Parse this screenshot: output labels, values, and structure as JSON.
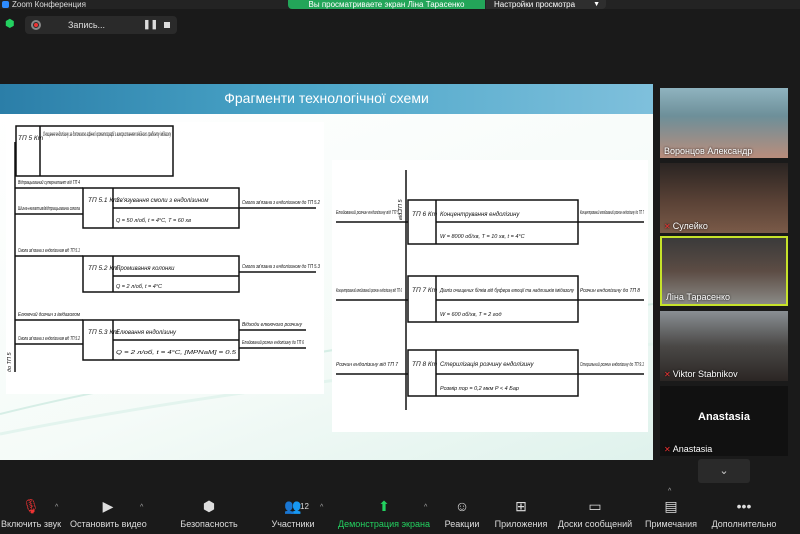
{
  "window": {
    "title": "Zoom Конференция"
  },
  "banner": {
    "text": "Вы просматриваете экран Ліна Тарасенко",
    "view_options": "Настройки просмотра"
  },
  "recording": {
    "label": "Запись..."
  },
  "slide": {
    "title": "Фрагменти технологічної схеми",
    "left": {
      "start_code": "ТП 5 Кт",
      "start_text": "Очищення ендолізину за допомогою афінної хроматографії з використанням лінійного градієнту імідазолу",
      "axis_label": "до ТП 5",
      "rows": [
        {
          "in1": "Відпрацьований супернатант від ТП 4",
          "in2": "Шина-негатив/відпрацьована смола",
          "code": "ТП 5.1 Кт",
          "text": "Зв'язування смоли з ендолізином",
          "params": "Q = 50 л/об, t = 4°С, T = 60 хв",
          "out": "Смола зв'язана з ендолізином до ТП 5.2"
        },
        {
          "in1": "Смола зв'язана з ендолізином від ТП 5.1",
          "code": "ТП 5.2 Кт",
          "text": "Промивання колонки",
          "params": "Q = 2 л/об, t = 4°С",
          "out": "Смола зв'язана з ендолізином до ТП 5.3"
        },
        {
          "in1": "Елюючий дозчин з імідазолом",
          "in2": "Смола зв'язана з ендолізином від ТП 5.2",
          "code": "ТП 5.3 Кт",
          "text": "Елювання ендолізину",
          "params": "Q = 2 л/об, t = 4°С, [MPNaM] = 0.5",
          "out": "Відходи елюючого розчину",
          "out2": "Елюйований розчин ендолізину до ТП 6"
        }
      ]
    },
    "right": {
      "axis_label": "від ТП 5",
      "rows": [
        {
          "in1": "Елюйований розчин ендолізину від ТП 5.3",
          "code": "ТП 6 Кт",
          "text": "Концентрування ендолізину",
          "params": "W = 8000 об/хв, T = 10 хв, t = 4°С",
          "out": "Концентрований елюйований розчин ендолізину до ТП 7"
        },
        {
          "in1": "Концентрований елюйований розчин ендолізину від ТП 6",
          "code": "ТП 7 Кт",
          "text": "Діаліз очищених білків від буфера елюції та надлишків імідазолу",
          "params": "W = 600 об/хв, T = 2 год",
          "out": "Розчин ендолізину до ТП 8"
        },
        {
          "in1": "Розчин ендолізину від ТП 7",
          "code": "ТП 8 Кт",
          "text": "Стерилізація розчину ендолізину",
          "params": "Розмір пор = 0,2 мкм P < 4 Бар",
          "out": "Стерильний розчин ендолізину до ТП 9.1"
        }
      ]
    }
  },
  "participants": [
    {
      "name": "Воронцов Александр",
      "muted": false
    },
    {
      "name": "Сулейко",
      "muted": true
    },
    {
      "name": "Ліна Тарасенко",
      "muted": false,
      "active": true
    },
    {
      "name": "Viktor Stabnikov",
      "muted": true
    },
    {
      "name": "Anastasia",
      "muted": true,
      "no_video": true
    }
  ],
  "toolbar": {
    "mute": "Включить звук",
    "video": "Остановить видео",
    "security": "Безопасность",
    "participants": "Участники",
    "participants_count": "12",
    "share": "Демонстрация экрана",
    "reactions": "Реакции",
    "apps": "Приложения",
    "whiteboards": "Доски сообщений",
    "notes": "Примечания",
    "more": "Дополнительно"
  }
}
